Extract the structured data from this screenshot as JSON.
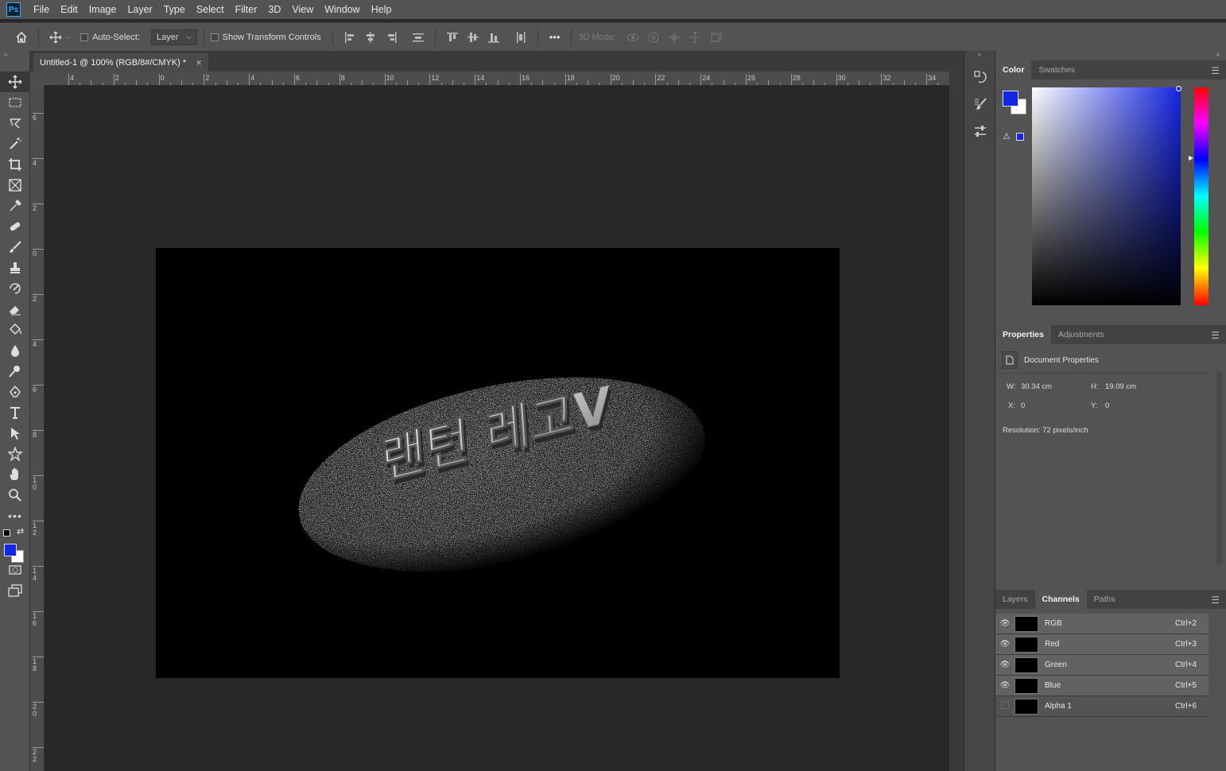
{
  "app": {
    "logo": "Ps"
  },
  "menu": [
    "File",
    "Edit",
    "Image",
    "Layer",
    "Type",
    "Select",
    "Filter",
    "3D",
    "View",
    "Window",
    "Help"
  ],
  "options": {
    "auto_select_label": "Auto-Select:",
    "auto_select_value": "Layer",
    "show_transform_label": "Show Transform Controls",
    "more": "•••",
    "mode_3d_label": "3D Mode:"
  },
  "document": {
    "tab_title": "Untitled-1 @ 100% (RGB/8#/CMYK) *",
    "close": "×",
    "artwork_text": "랜턴 레고V"
  },
  "ruler_h": [
    "4",
    "2",
    "0",
    "2",
    "4",
    "6",
    "8",
    "10",
    "12",
    "14",
    "16",
    "18",
    "20",
    "22",
    "24",
    "26",
    "28",
    "30",
    "32",
    "34"
  ],
  "ruler_v": [
    "6",
    "4",
    "2",
    "0",
    "2",
    "4",
    "6",
    "8",
    "1\n0",
    "1\n2",
    "1\n4",
    "1\n6",
    "1\n8",
    "2\n0",
    "2\n2"
  ],
  "colors": {
    "foreground": "#1426e3",
    "background": "#ffffff",
    "accent": "#1426e3"
  },
  "color_panel": {
    "tabs": [
      "Color",
      "Swatches"
    ],
    "gamut_warning_icon": "warning-icon"
  },
  "properties_panel": {
    "tabs": [
      "Properties",
      "Adjustments"
    ],
    "title": "Document Properties",
    "w_label": "W:",
    "w_value": "30.34 cm",
    "h_label": "H:",
    "h_value": "19.09 cm",
    "x_label": "X:",
    "x_value": "0",
    "y_label": "Y:",
    "y_value": "0",
    "resolution": "Resolution: 72 pixels/inch"
  },
  "channels_panel": {
    "tabs": [
      "Layers",
      "Channels",
      "Paths"
    ],
    "rows": [
      {
        "name": "RGB",
        "shortcut": "Ctrl+2",
        "visible": true
      },
      {
        "name": "Red",
        "shortcut": "Ctrl+3",
        "visible": true
      },
      {
        "name": "Green",
        "shortcut": "Ctrl+4",
        "visible": true
      },
      {
        "name": "Blue",
        "shortcut": "Ctrl+5",
        "visible": true
      },
      {
        "name": "Alpha 1",
        "shortcut": "Ctrl+6",
        "visible": false
      }
    ]
  }
}
